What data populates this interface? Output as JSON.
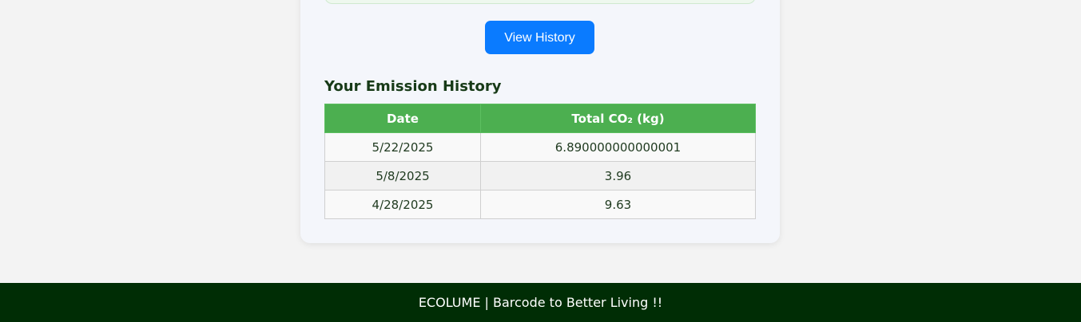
{
  "actions": {
    "view_history_label": "View History"
  },
  "history": {
    "title": "Your Emission History",
    "columns": [
      "Date",
      "Total CO₂ (kg)"
    ],
    "rows": [
      {
        "date": "5/22/2025",
        "total": "6.890000000000001"
      },
      {
        "date": "5/8/2025",
        "total": "3.96"
      },
      {
        "date": "4/28/2025",
        "total": "9.63"
      }
    ]
  },
  "footer": {
    "text": "ECOLUME | Barcode to Better Living !!"
  }
}
